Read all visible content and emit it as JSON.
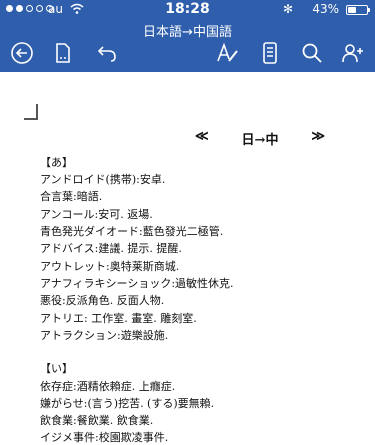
{
  "status": {
    "carrier": "au",
    "time": "18:28",
    "battery": "43%",
    "battery_level": 0.43,
    "bluetooth": "✻"
  },
  "doc_title": "日本語→中国語",
  "toolbar": [
    "back-icon",
    "file-icon",
    "undo-icon",
    "font-pen-icon",
    "mobile-view-icon",
    "search-icon",
    "add-person-icon"
  ],
  "document": {
    "heading": {
      "left": "≪",
      "text": "日→中",
      "right": "≫"
    },
    "section_a": {
      "title": "【あ】",
      "lines": [
        "アンドロイド(携帯):安卓.",
        "合言葉:暗語.",
        "アンコール:安可. 返場.",
        "青色発光ダイオード:藍色發光二極管.",
        "アドバイス:建議. 提示. 提醒.",
        "アウトレット:奥特莱斯商城.",
        "アナフィラキシーショック:過敏性休克.",
        "悪役:反派角色. 反面人物.",
        "アトリエ: 工作室. 畫室. 雕刻室.",
        "アトラクション:遊樂設施."
      ]
    },
    "section_i": {
      "title": "【い】",
      "lines": [
        "依存症:酒精依賴症. 上癮症.",
        "嫌がらせ:(言う)挖苦. (する)要無賴.",
        "飲食業:餐飲業. 飲食業.",
        "イジメ事件:校園欺凌事件."
      ]
    }
  }
}
